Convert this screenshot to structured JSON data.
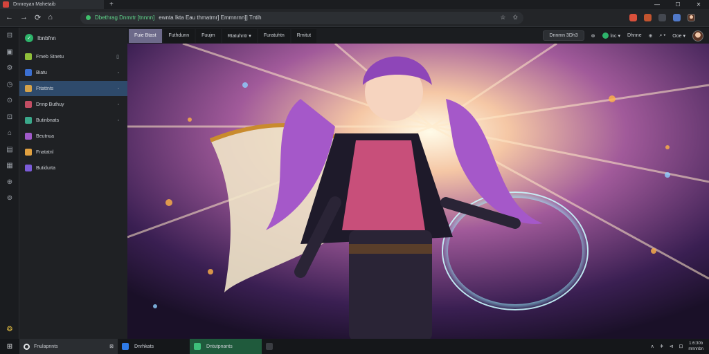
{
  "browser": {
    "tab_title": "Dnnrayan Mahetaib",
    "new_tab": "+",
    "window_controls": [
      "—",
      "☐",
      "✕"
    ],
    "nav": {
      "back": "←",
      "forward": "→",
      "reload": "⟳",
      "home": "⌂"
    },
    "url_highlight": "Dbethrag Dnmrtr [tnnnn]",
    "url_rest": "ewnta Ikta Eau thmatrnr] Emmnrnn]] Tntih",
    "omnibox_icons": [
      "☆",
      "✩"
    ],
    "extensions_colors": [
      "#d9503b",
      "#c2542f",
      "#444850",
      "#5079c9"
    ]
  },
  "rail": {
    "icons": [
      "⊟",
      "▣",
      "⚙",
      "◷",
      "⊙",
      "⊡",
      "⌂",
      "▤",
      "▦",
      "⊕",
      "⊚"
    ],
    "bottom_icon": "❂"
  },
  "sidebar": {
    "title": "Ibnbfnn",
    "logo": "✓",
    "items": [
      {
        "label": "Fmeb Stnetu",
        "color": "#8fbf3a",
        "action": "▯",
        "active": false
      },
      {
        "label": "Biatu",
        "color": "#3b6fd1",
        "action": "◦",
        "active": false
      },
      {
        "label": "Fttattnts",
        "color": "#d4a24a",
        "action": "◦",
        "active": true
      },
      {
        "label": "Dnnp Buthuy",
        "color": "#c24d63",
        "action": "◦",
        "active": false
      },
      {
        "label": "Butinbnats",
        "color": "#3aa88a",
        "action": "◦",
        "active": false
      },
      {
        "label": "Beutnua",
        "color": "#a05ac9",
        "action": "",
        "active": false
      },
      {
        "label": "Fnatatnl",
        "color": "#e0a040",
        "action": "",
        "active": false
      },
      {
        "label": "Butidurta",
        "color": "#7b5bd8",
        "action": "",
        "active": false
      }
    ]
  },
  "content_tabs": [
    {
      "label": "Fuie Btast",
      "active": true
    },
    {
      "label": "Futhdunn",
      "active": false
    },
    {
      "label": "Fuujm",
      "active": false
    },
    {
      "label": "Rtatuhntr ▾",
      "active": false
    },
    {
      "label": "Furatuhtn",
      "active": false
    },
    {
      "label": "Rmitut",
      "active": false
    }
  ],
  "toolbar_right": {
    "search_pill": "Dnnmn 3Dh3",
    "items": [
      "⊛",
      "lnc ▾",
      "Dhnne",
      "⊕",
      "⌕ ▾",
      "Ooe ▾"
    ]
  },
  "taskbar": {
    "start": "⊞",
    "search_label": "Fnulapnnts",
    "search_tail": "⊠",
    "apps": [
      {
        "label": "Dnrhkats",
        "color": "#2f7be8",
        "active": false
      },
      {
        "label": "Dntutpnants",
        "color": "#3dbf7a",
        "active": true
      },
      {
        "label": "",
        "color": "#3a3d42",
        "active": false
      }
    ],
    "tray": [
      "∧",
      "✈",
      "⊲",
      "⊡"
    ],
    "time": "1:6:30b",
    "date": "mnnnbn"
  }
}
